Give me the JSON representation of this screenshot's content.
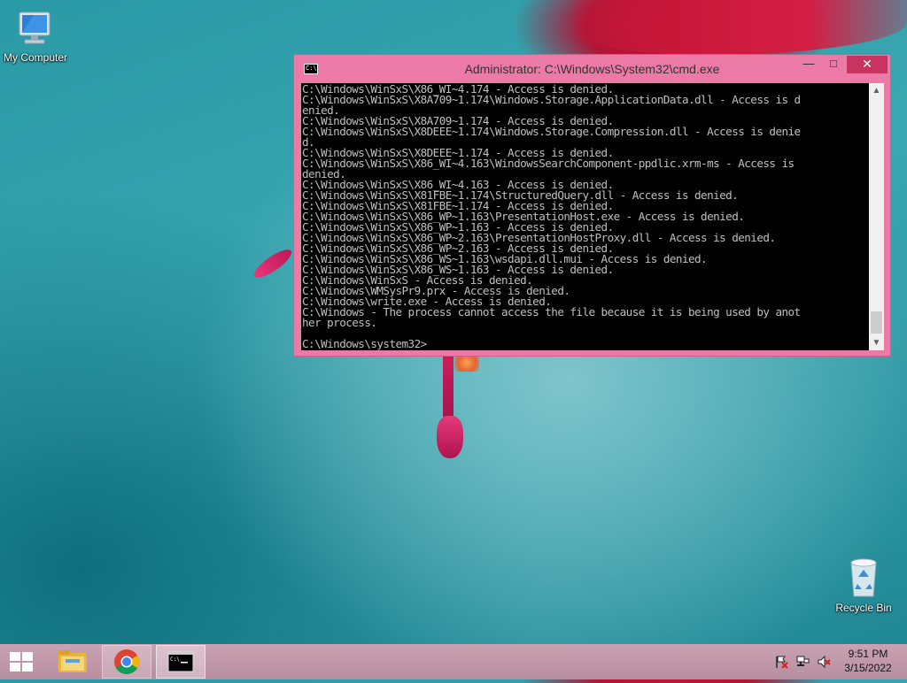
{
  "desktop": {
    "icons": {
      "my_computer": {
        "label": "My Computer"
      },
      "recycle_bin": {
        "label": "Recycle Bin"
      }
    }
  },
  "cmd_window": {
    "title": "Administrator: C:\\Windows\\System32\\cmd.exe",
    "controls": {
      "minimize": "—",
      "maximize": "□",
      "close": "✕"
    },
    "lines": [
      "C:\\Windows\\WinSxS\\X86_WI~4.174 - Access is denied.",
      "C:\\Windows\\WinSxS\\X8A709~1.174\\Windows.Storage.ApplicationData.dll - Access is d",
      "enied.",
      "C:\\Windows\\WinSxS\\X8A709~1.174 - Access is denied.",
      "C:\\Windows\\WinSxS\\X8DEEE~1.174\\Windows.Storage.Compression.dll - Access is denie",
      "d.",
      "C:\\Windows\\WinSxS\\X8DEEE~1.174 - Access is denied.",
      "C:\\Windows\\WinSxS\\X86_WI~4.163\\WindowsSearchComponent-ppdlic.xrm-ms - Access is",
      "denied.",
      "C:\\Windows\\WinSxS\\X86_WI~4.163 - Access is denied.",
      "C:\\Windows\\WinSxS\\X81FBE~1.174\\StructuredQuery.dll - Access is denied.",
      "C:\\Windows\\WinSxS\\X81FBE~1.174 - Access is denied.",
      "C:\\Windows\\WinSxS\\X86_WP~1.163\\PresentationHost.exe - Access is denied.",
      "C:\\Windows\\WinSxS\\X86_WP~1.163 - Access is denied.",
      "C:\\Windows\\WinSxS\\X86_WP~2.163\\PresentationHostProxy.dll - Access is denied.",
      "C:\\Windows\\WinSxS\\X86_WP~2.163 - Access is denied.",
      "C:\\Windows\\WinSxS\\X86_WS~1.163\\wsdapi.dll.mui - Access is denied.",
      "C:\\Windows\\WinSxS\\X86_WS~1.163 - Access is denied.",
      "C:\\Windows\\WinSxS - Access is denied.",
      "C:\\Windows\\WMSysPr9.prx - Access is denied.",
      "C:\\Windows\\write.exe - Access is denied.",
      "C:\\Windows - The process cannot access the file because it is being used by anot",
      "her process.",
      "",
      "C:\\Windows\\system32>"
    ]
  },
  "taskbar": {
    "tray": {
      "flag_icon": "flag-icon",
      "network_icon": "network-icon",
      "volume_icon": "volume-muted-icon"
    },
    "clock": {
      "time": "9:51 PM",
      "date": "3/15/2022"
    }
  }
}
